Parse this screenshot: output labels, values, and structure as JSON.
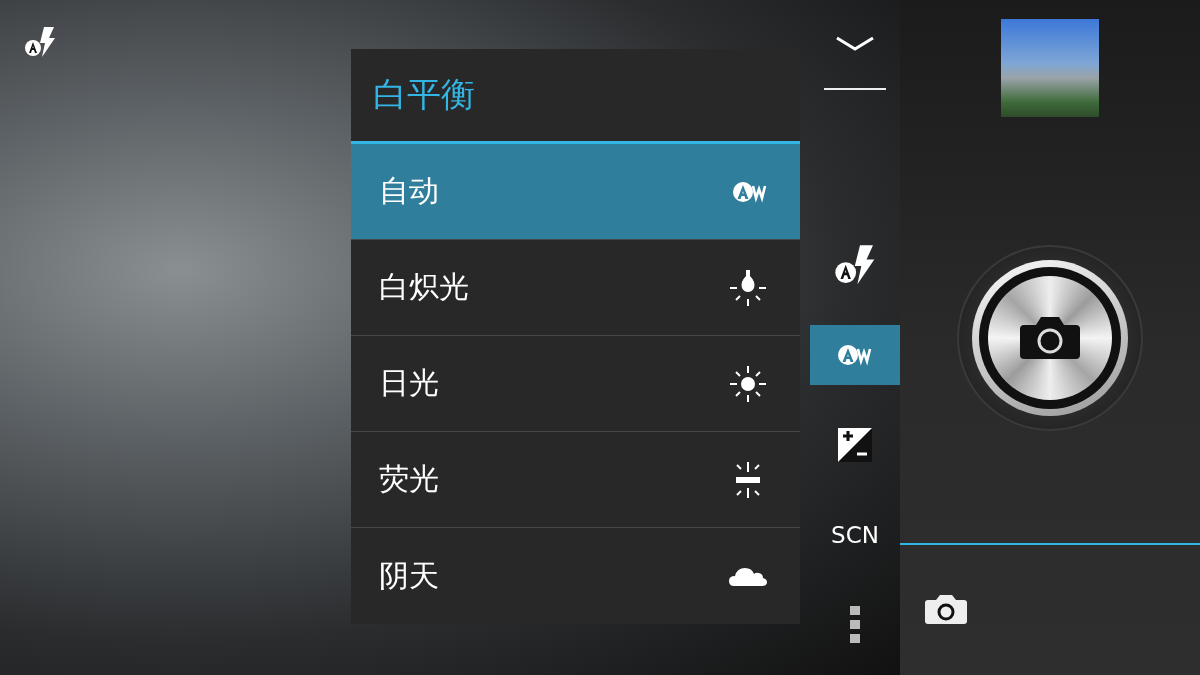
{
  "white_balance_menu": {
    "title": "白平衡",
    "options": [
      {
        "label": "自动",
        "kind": "auto",
        "selected": true
      },
      {
        "label": "白炽光",
        "kind": "incandescent",
        "selected": false
      },
      {
        "label": "日光",
        "kind": "daylight",
        "selected": false
      },
      {
        "label": "荧光",
        "kind": "fluorescent",
        "selected": false
      },
      {
        "label": "阴天",
        "kind": "cloudy",
        "selected": false
      }
    ]
  },
  "side_controls": [
    {
      "kind": "collapse",
      "selected": false
    },
    {
      "kind": "flash",
      "selected": false
    },
    {
      "kind": "white_balance",
      "selected": true
    },
    {
      "kind": "exposure",
      "selected": false
    },
    {
      "kind": "scene",
      "label": "SCN",
      "selected": false
    },
    {
      "kind": "more",
      "selected": false
    }
  ]
}
